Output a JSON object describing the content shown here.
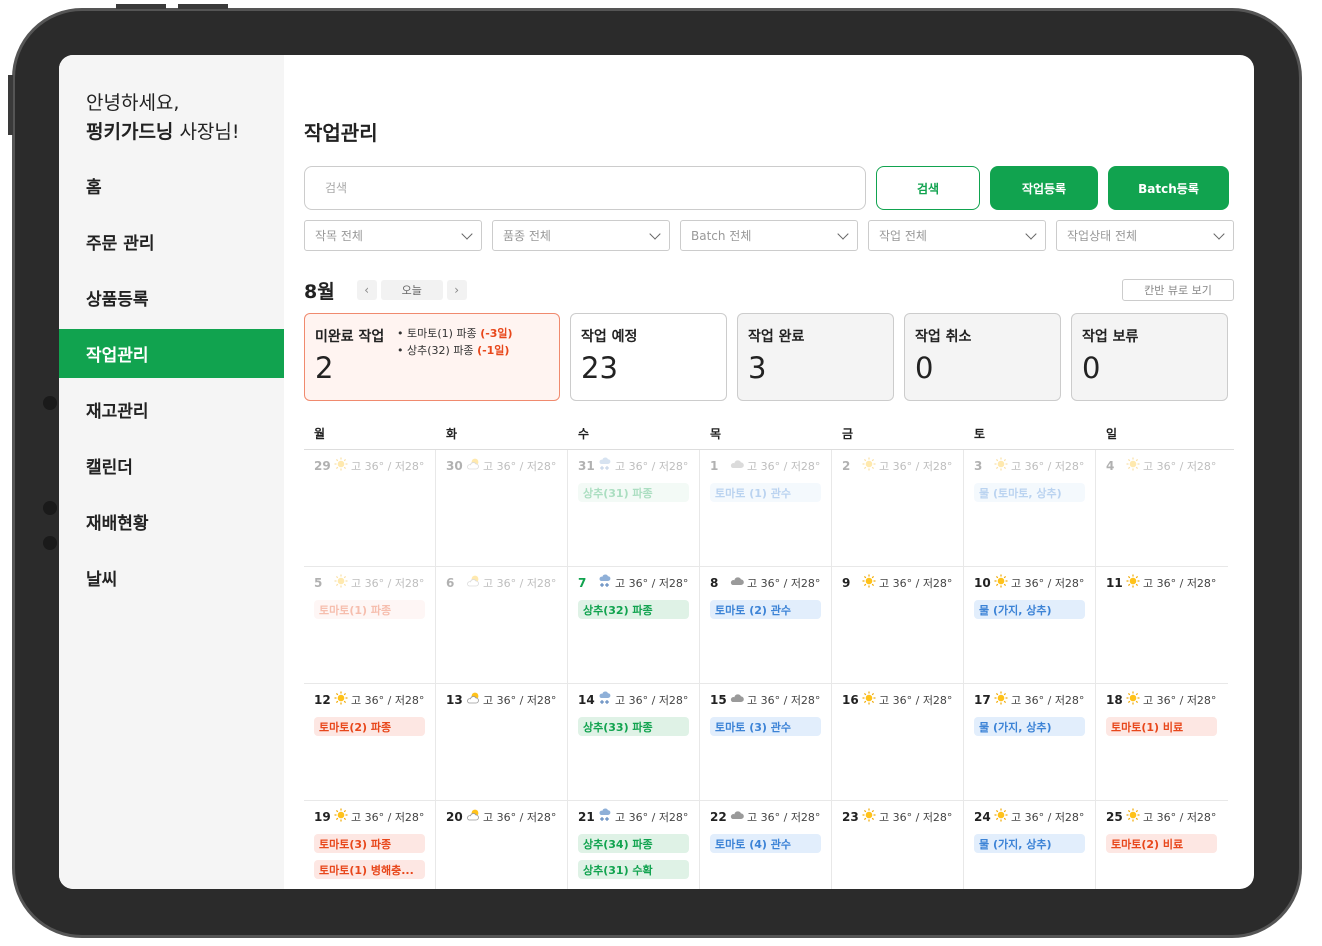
{
  "sidebar": {
    "greeting_line1": "안녕하세요,",
    "greeting_name": "펑키가드닝",
    "greeting_suffix": " 사장님!",
    "items": [
      "홈",
      "주문 관리",
      "상품등록",
      "작업관리",
      "재고관리",
      "캘린더",
      "재배현황",
      "날씨"
    ],
    "active_index": 3
  },
  "page_title": "작업관리",
  "search": {
    "placeholder": "검색",
    "search_label": "검색",
    "register_label": "작업등록",
    "batch_label": "Batch등록"
  },
  "filters": [
    "작목 전체",
    "품종 전체",
    "Batch 전체",
    "작업 전체",
    "작업상태 전체"
  ],
  "calendar_header": {
    "month": "8월",
    "today_label": "오늘",
    "prev": "‹",
    "next": "›",
    "kanban_label": "칸반 뷰로 보기"
  },
  "stats": [
    {
      "title": "미완료 작업",
      "value": "2",
      "style": "alert"
    },
    {
      "title": "작업 예정",
      "value": "23",
      "style": "white"
    },
    {
      "title": "작업 완료",
      "value": "3",
      "style": "gray"
    },
    {
      "title": "작업 취소",
      "value": "0",
      "style": "gray"
    },
    {
      "title": "작업 보류",
      "value": "0",
      "style": "gray"
    }
  ],
  "overdue": [
    {
      "text": "토마토(1) 파종 ",
      "delay": "(-3일)"
    },
    {
      "text": "상추(32) 파종 ",
      "delay": "(-1일)"
    }
  ],
  "weekdays": [
    "월",
    "화",
    "수",
    "목",
    "금",
    "토",
    "일"
  ],
  "temp_text": "고 36° / 저28°",
  "colors": {
    "accent": "#11a34f",
    "alert": "#e8471b",
    "blue": "#3c83d6"
  },
  "weeks": [
    [
      {
        "d": "29",
        "w": "sun",
        "faded": true,
        "tags": []
      },
      {
        "d": "30",
        "w": "partly",
        "faded": true,
        "tags": []
      },
      {
        "d": "31",
        "w": "snow",
        "faded": true,
        "tags": [
          {
            "t": "상추(31) 파종",
            "c": "green"
          }
        ]
      },
      {
        "d": "1",
        "w": "cloud",
        "faded": true,
        "tags": [
          {
            "t": "토마토 (1) 관수",
            "c": "blue"
          }
        ]
      },
      {
        "d": "2",
        "w": "sun",
        "faded": true,
        "tags": []
      },
      {
        "d": "3",
        "w": "sun",
        "faded": true,
        "tags": [
          {
            "t": "물 (토마토, 상추)",
            "c": "blue"
          }
        ]
      },
      {
        "d": "4",
        "w": "sun",
        "faded": true,
        "tags": []
      }
    ],
    [
      {
        "d": "5",
        "w": "sun",
        "faded": true,
        "tags": [
          {
            "t": "토마토(1) 파종",
            "c": "red"
          }
        ]
      },
      {
        "d": "6",
        "w": "partly",
        "faded": true,
        "tags": []
      },
      {
        "d": "7",
        "w": "snow",
        "today": true,
        "tags": [
          {
            "t": "상추(32) 파종",
            "c": "green"
          }
        ]
      },
      {
        "d": "8",
        "w": "cloud",
        "tags": [
          {
            "t": "토마토 (2) 관수",
            "c": "blue"
          }
        ]
      },
      {
        "d": "9",
        "w": "sun",
        "tags": []
      },
      {
        "d": "10",
        "w": "sun",
        "tags": [
          {
            "t": "물 (가지, 상추)",
            "c": "blue"
          }
        ]
      },
      {
        "d": "11",
        "w": "sun",
        "tags": []
      }
    ],
    [
      {
        "d": "12",
        "w": "sun",
        "tags": [
          {
            "t": "토마토(2) 파종",
            "c": "red"
          }
        ]
      },
      {
        "d": "13",
        "w": "partly",
        "tags": []
      },
      {
        "d": "14",
        "w": "snow",
        "tags": [
          {
            "t": "상추(33) 파종",
            "c": "green"
          }
        ]
      },
      {
        "d": "15",
        "w": "cloud",
        "tags": [
          {
            "t": "토마토 (3) 관수",
            "c": "blue"
          }
        ]
      },
      {
        "d": "16",
        "w": "sun",
        "tags": []
      },
      {
        "d": "17",
        "w": "sun",
        "tags": [
          {
            "t": "물 (가지, 상추)",
            "c": "blue"
          }
        ]
      },
      {
        "d": "18",
        "w": "sun",
        "tags": [
          {
            "t": "토마토(1) 비료",
            "c": "red"
          }
        ]
      }
    ],
    [
      {
        "d": "19",
        "w": "sun",
        "tags": [
          {
            "t": "토마토(3) 파종",
            "c": "red"
          },
          {
            "t": "토마토(1) 병해충...",
            "c": "red"
          }
        ]
      },
      {
        "d": "20",
        "w": "partly",
        "tags": []
      },
      {
        "d": "21",
        "w": "snow",
        "tags": [
          {
            "t": "상추(34) 파종",
            "c": "green"
          },
          {
            "t": "상추(31) 수확",
            "c": "green"
          }
        ]
      },
      {
        "d": "22",
        "w": "cloud",
        "tags": [
          {
            "t": "토마토 (4) 관수",
            "c": "blue"
          }
        ]
      },
      {
        "d": "23",
        "w": "sun",
        "tags": []
      },
      {
        "d": "24",
        "w": "sun",
        "tags": [
          {
            "t": "물 (가지, 상추)",
            "c": "blue"
          }
        ]
      },
      {
        "d": "25",
        "w": "sun",
        "tags": [
          {
            "t": "토마토(2) 비료",
            "c": "red"
          }
        ]
      }
    ]
  ]
}
